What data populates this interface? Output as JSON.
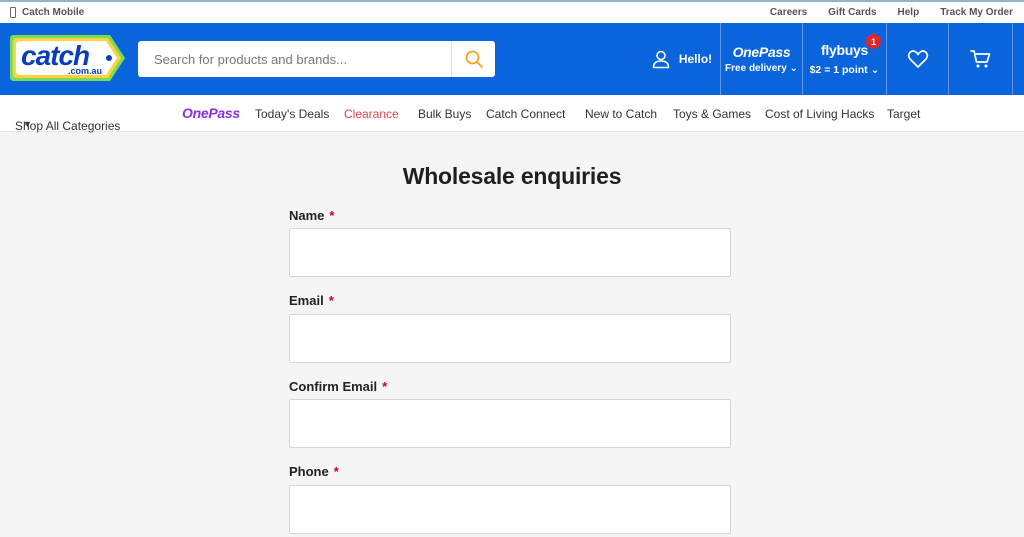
{
  "utility": {
    "mobile": "Catch Mobile",
    "links": [
      "Careers",
      "Gift Cards",
      "Help",
      "Track My Order"
    ]
  },
  "header": {
    "logo": "catch",
    "logo_sub": ".com.au",
    "search_placeholder": "Search for products and brands...",
    "hello": "Hello!",
    "onepass_brand": "OnePass",
    "onepass_sub": "Free delivery",
    "flybuys_brand": "flybuys",
    "flybuys_sub": "$2 = 1 point",
    "flybuys_badge": "1"
  },
  "nav": {
    "shop_all": "Shop All Categories",
    "onepass": "OnePass",
    "items": [
      "Today's Deals",
      "Clearance",
      "Bulk Buys",
      "Catch Connect",
      "New to Catch",
      "Toys & Games",
      "Cost of Living Hacks",
      "Target"
    ]
  },
  "form": {
    "title": "Wholesale enquiries",
    "required_mark": "*",
    "fields": [
      {
        "label": "Name",
        "value": ""
      },
      {
        "label": "Email",
        "value": ""
      },
      {
        "label": "Confirm Email",
        "value": ""
      },
      {
        "label": "Phone",
        "value": ""
      }
    ]
  },
  "colors": {
    "brand_blue": "#0a64dc",
    "onepass_purple": "#8b2fe0",
    "clearance_red": "#e0454a",
    "required_red": "#d0021b",
    "search_accent": "#f5a623"
  }
}
